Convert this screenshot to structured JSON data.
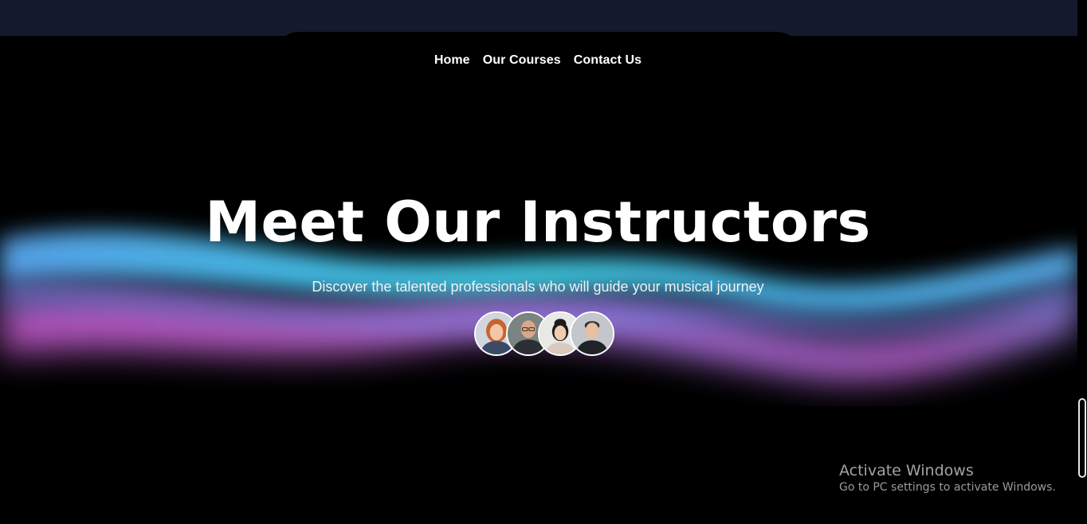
{
  "nav": {
    "items": [
      {
        "label": "Home"
      },
      {
        "label": "Our Courses"
      },
      {
        "label": "Contact Us"
      }
    ]
  },
  "hero": {
    "title": "Meet Our Instructors",
    "subtitle": "Discover the talented professionals who will guide your musical journey"
  },
  "avatars": [
    {
      "icon": "instructor-avatar-1"
    },
    {
      "icon": "instructor-avatar-2"
    },
    {
      "icon": "instructor-avatar-3"
    },
    {
      "icon": "instructor-avatar-4"
    }
  ],
  "colors": {
    "background": "#000000",
    "top_band": "#141a2b",
    "wave_blue": "#4fb8f0",
    "wave_pink": "#d46ce0"
  },
  "watermark": {
    "title": "Activate Windows",
    "subtitle": "Go to PC settings to activate Windows."
  }
}
